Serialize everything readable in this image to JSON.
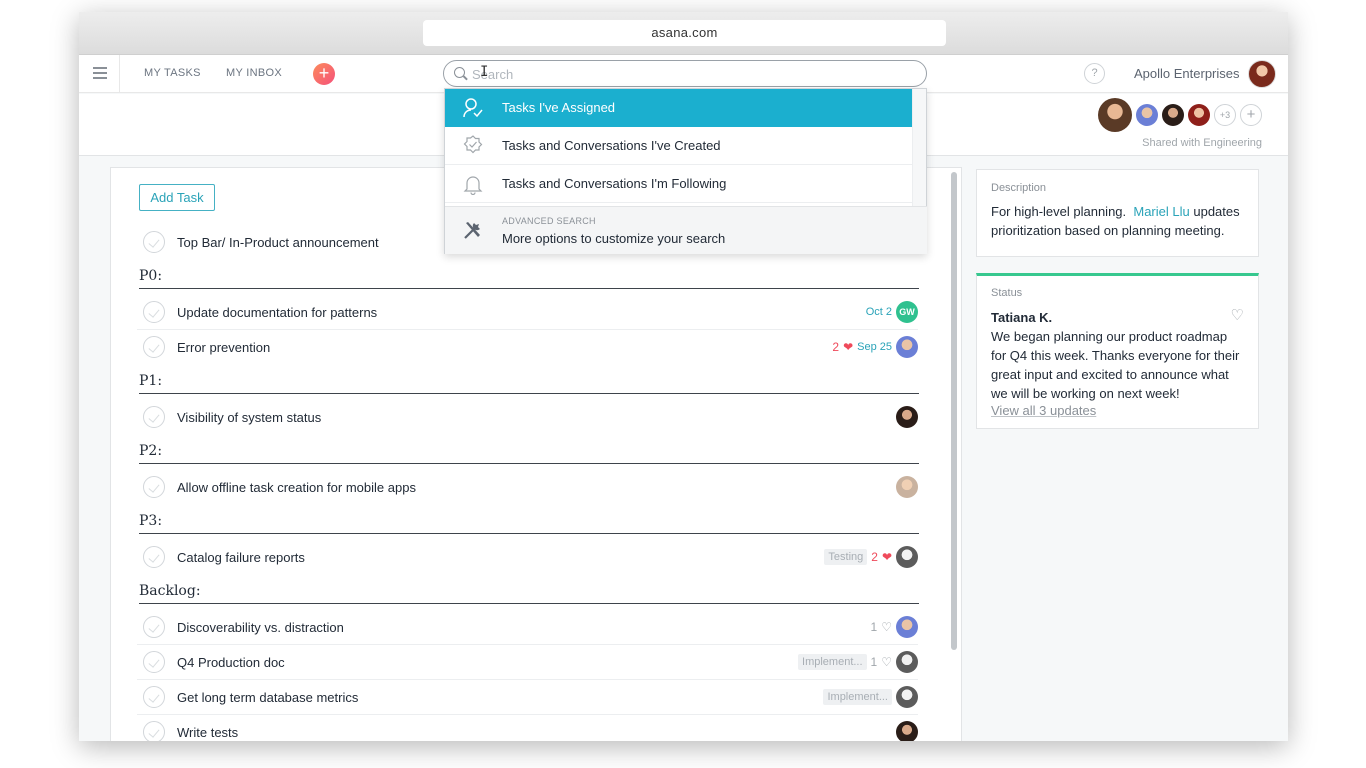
{
  "browser": {
    "url": "asana.com"
  },
  "topbar": {
    "my_tasks": "MY TASKS",
    "my_inbox": "MY INBOX",
    "search_placeholder": "Search",
    "help": "?",
    "org_name": "Apollo Enterprises"
  },
  "project": {
    "members_more": "+3",
    "shared_with": "Shared with Engineering"
  },
  "search_dropdown": {
    "items": [
      {
        "label": "Tasks I've Assigned",
        "icon": "assign-icon",
        "active": true
      },
      {
        "label": "Tasks and Conversations I've Created",
        "icon": "badge-check-icon",
        "active": false
      },
      {
        "label": "Tasks and Conversations I'm Following",
        "icon": "bell-icon",
        "active": false
      }
    ],
    "advanced": {
      "caption": "ADVANCED SEARCH",
      "text": "More options to customize your search",
      "icon": "tools-icon"
    }
  },
  "tasklist": {
    "add_task": "Add Task",
    "top_task": "Top Bar/ In-Product announcement",
    "sections": [
      {
        "name": "P0:",
        "tasks": [
          {
            "title": "Update documentation for patterns",
            "date": "Oct 2",
            "assignee": "GW"
          },
          {
            "title": "Error prevention",
            "hearts": "2",
            "date": "Sep 25"
          }
        ]
      },
      {
        "name": "P1:",
        "tasks": [
          {
            "title": "Visibility of system status"
          }
        ]
      },
      {
        "name": "P2:",
        "tasks": [
          {
            "title": "Allow offline task creation for mobile apps"
          }
        ]
      },
      {
        "name": "P3:",
        "tasks": [
          {
            "title": "Catalog failure reports",
            "tag": "Testing",
            "hearts": "2"
          }
        ]
      },
      {
        "name": "Backlog:",
        "tasks": [
          {
            "title": "Discoverability vs. distraction",
            "likes": "1"
          },
          {
            "title": "Q4 Production doc",
            "tag": "Implement...",
            "likes": "1"
          },
          {
            "title": "Get long term database metrics",
            "tag": "Implement..."
          },
          {
            "title": "Write tests"
          }
        ]
      }
    ]
  },
  "description": {
    "label": "Description",
    "text_before": "For high-level planning.",
    "mention": "Mariel Llu",
    "text_after": "updates prioritization based on planning meeting."
  },
  "status": {
    "label": "Status",
    "author": "Tatiana K.",
    "text": "We began planning our product roadmap for Q4 this week. Thanks everyone for their great input and excited to announce what we will be working on next week!",
    "view_all": "View all 3 updates",
    "accent_color": "#37c88f"
  },
  "colors": {
    "accent": "#1bafcf",
    "heart": "#ef4a5b",
    "add_button": "#f5517a"
  }
}
